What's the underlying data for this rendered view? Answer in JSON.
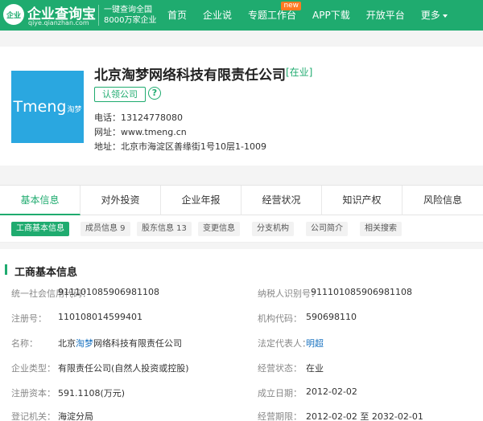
{
  "header": {
    "logo_badge": "企业",
    "logo_name": "企业查询宝",
    "logo_domain": "qiye.qianzhan.com",
    "slogan_line1": "一键查询全国",
    "slogan_line2": "8000万家企业",
    "nav": [
      {
        "label": "首页"
      },
      {
        "label": "企业说"
      },
      {
        "label": "专题工作台",
        "badge": "new"
      },
      {
        "label": "APP下载"
      },
      {
        "label": "开放平台"
      },
      {
        "label": "更多"
      }
    ]
  },
  "company": {
    "logo_text": "Tmeng",
    "logo_sub": "淘梦",
    "name": "北京淘梦网络科技有限责任公司",
    "status": "[在业]",
    "claim_label": "认领公司",
    "phone": "电话：13124778080",
    "website": "网址：www.tmeng.cn",
    "address": "地址：北京市海淀区善缘街1号10层1-1009"
  },
  "tabs": [
    "基本信息",
    "对外投资",
    "企业年报",
    "经营状况",
    "知识产权",
    "风险信息"
  ],
  "subtabs": [
    "工商基本信息",
    "成员信息 9",
    "股东信息 13",
    "变更信息",
    "分支机构",
    "公司简介",
    "相关搜索"
  ],
  "details": {
    "title": "工商基本信息",
    "rows": [
      {
        "k1": "统一社会信用代码：",
        "v1": "911101085906981108",
        "k2": "纳税人识别号：",
        "v2": "911101085906981108"
      },
      {
        "k1": "注册号：",
        "v1": "110108014599401",
        "k2": "机构代码：",
        "v2": "590698110"
      },
      {
        "k1": "名称：",
        "v1a": "北京",
        "v1b": "淘梦",
        "v1c": "网络科技有限责任公司",
        "k2": "法定代表人：",
        "v2": "明超"
      },
      {
        "k1": "企业类型：",
        "v1": "有限责任公司(自然人投资或控股)",
        "k2": "经营状态：",
        "v2": "在业"
      },
      {
        "k1": "注册资本：",
        "v1": "591.1108(万元)",
        "k2": "成立日期：",
        "v2": "2012-02-02"
      },
      {
        "k1": "登记机关：",
        "v1": "海淀分局",
        "k2": "经营期限：",
        "v2": "2012-02-02 至 2032-02-01"
      }
    ]
  }
}
